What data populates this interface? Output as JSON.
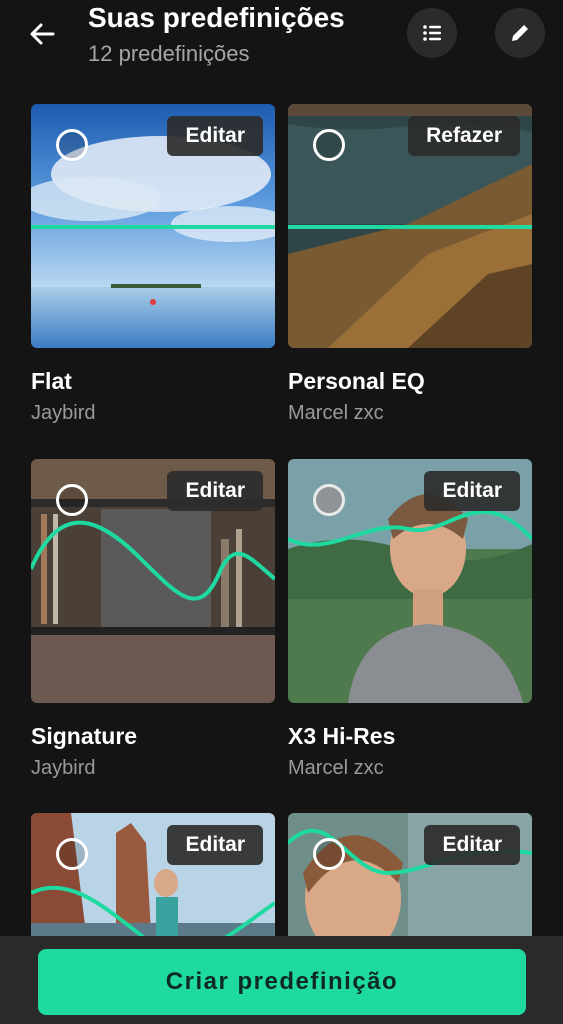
{
  "header": {
    "title": "Suas predefinições",
    "subtitle": "12 predefinições"
  },
  "presets": [
    {
      "name": "Flat",
      "author": "Jaybird",
      "action": "Editar",
      "selected": false
    },
    {
      "name": "Personal EQ",
      "author": "Marcel zxc",
      "action": "Refazer",
      "selected": false
    },
    {
      "name": "Signature",
      "author": "Jaybird",
      "action": "Editar",
      "selected": false
    },
    {
      "name": "X3 Hi-Res",
      "author": "Marcel zxc",
      "action": "Editar",
      "selected": true
    },
    {
      "name": "",
      "author": "",
      "action": "Editar",
      "selected": false
    },
    {
      "name": "",
      "author": "",
      "action": "Editar",
      "selected": false
    }
  ],
  "footer": {
    "create_label": "Criar predefinição"
  },
  "colors": {
    "accent": "#1ed9a0",
    "background": "#141414"
  }
}
